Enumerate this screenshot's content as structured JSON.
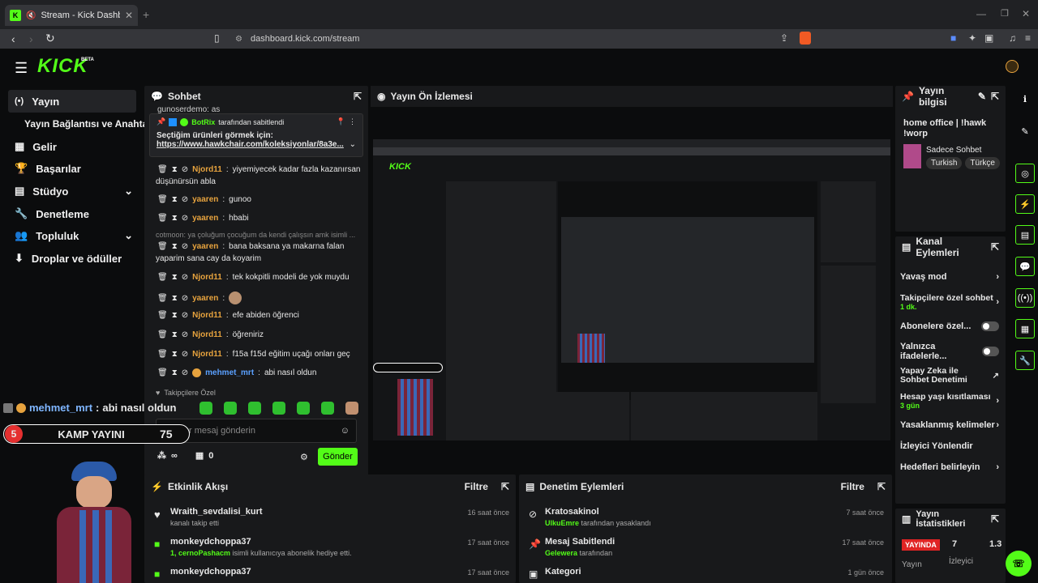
{
  "browser": {
    "tab_title": "Stream - Kick Dashboard",
    "url": "dashboard.kick.com/stream"
  },
  "brand": {
    "logo": "KICK",
    "beta": "BETA",
    "accent": "#53fc18"
  },
  "sidebar": {
    "items": [
      {
        "label": "Yayın",
        "icon": "broadcast-icon"
      },
      {
        "label": "Yayın Bağlantısı ve Anahtarı"
      },
      {
        "label": "Gelir",
        "icon": "chart-icon"
      },
      {
        "label": "Başarılar",
        "icon": "trophy-icon"
      },
      {
        "label": "Stüdyo",
        "icon": "studio-icon"
      },
      {
        "label": "Denetleme",
        "icon": "wrench-icon"
      },
      {
        "label": "Topluluk",
        "icon": "community-icon"
      },
      {
        "label": "Droplar ve ödüller",
        "icon": "drops-icon"
      }
    ]
  },
  "chat": {
    "title": "Sohbet",
    "top_cut": "gunoserdemo: as",
    "pinned": {
      "by_user": "BotRix",
      "by_text": "tarafından sabitlendi",
      "line1": "Seçtiğim ürünleri görmek için:",
      "line2": "https://www.hawkchair.com/koleksiyonlar/8a3e..."
    },
    "messages": [
      {
        "user": "Njord11",
        "text": "yiyemiyecek kadar fazla kazanırsan",
        "text2": "düşünürsün abla"
      },
      {
        "user": "yaaren",
        "text": "gunoo"
      },
      {
        "user": "yaaren",
        "text": "hbabi"
      },
      {
        "reply": "cotmoon: ya çoluğum çocuğum da kendi çalışsın amk isimli ..."
      },
      {
        "user": "yaaren",
        "text": "bana baksana ya makarna falan",
        "text2": "yaparim sana cay da koyarim"
      },
      {
        "user": "Njord11",
        "text": "tek kokpitli modeli de yok muydu"
      },
      {
        "user": "yaaren",
        "text": ""
      },
      {
        "user": "Njord11",
        "text": "efe abiden öğrenci"
      },
      {
        "user": "Njord11",
        "text": "öğreniriz"
      },
      {
        "user": "Njord11",
        "text": "f15a f15d eğitim uçağı onları geç"
      },
      {
        "user": "mehmet_mrt",
        "text": "abi nasıl oldun"
      }
    ],
    "followers_only": "Takipçilere Özel",
    "input_placeholder": "r mesaj gönderin",
    "send_label": "Gönder",
    "counter_left": "∞",
    "counter_right": "0"
  },
  "preview": {
    "title": "Yayın Ön İzlemesi",
    "overlay_user": "mehmet_mrt",
    "overlay_text": "abi nasıl oldun",
    "overlay_level": "5",
    "overlay_banner": "KAMP YAYINI",
    "overlay_number": "75"
  },
  "stream_info": {
    "title": "Yayın bilgisi",
    "stream_title": "home office | !hawk !worp",
    "category": "Sadece Sohbet",
    "tags": [
      "Turkish",
      "Türkçe"
    ]
  },
  "channel_actions": {
    "title": "Kanal Eylemleri",
    "items": [
      {
        "label": "Yavaş mod",
        "type": "arrow"
      },
      {
        "label": "Takipçilere özel sohbet",
        "sub": "1 dk.",
        "type": "arrow"
      },
      {
        "label": "Abonelere özel...",
        "type": "toggle"
      },
      {
        "label": "Yalnızca ifadelerle...",
        "type": "toggle"
      },
      {
        "label": "Yapay Zeka ile Sohbet Denetimi",
        "type": "external"
      },
      {
        "label": "Hesap yaşı kısıtlaması",
        "sub": "3 gün",
        "type": "arrow"
      },
      {
        "label": "Yasaklanmış kelimeler",
        "type": "arrow"
      },
      {
        "label": "İzleyici Yönlendir",
        "type": "none"
      },
      {
        "label": "Hedefleri belirleyin",
        "type": "arrow"
      }
    ]
  },
  "stats": {
    "title": "Yayın İstatistikleri",
    "live": "YAYINDA",
    "live_sub": "Yayın",
    "viewers": "7",
    "viewers_label": "İzleyici",
    "extra": "1.3"
  },
  "activity": {
    "title": "Etkinlik Akışı",
    "filter": "Filtre",
    "rows": [
      {
        "user": "Wraith_sevdalisi_kurt",
        "sub": "kanalı takip etti",
        "time": "16 saat önce",
        "icon": "heart-icon"
      },
      {
        "user": "monkeydchoppa37",
        "sub_user": "1, cernoPashacm",
        "sub": "isimli kullanıcıya abonelik hediye etti.",
        "time": "17 saat önce",
        "icon": "gift-icon"
      },
      {
        "user": "monkeydchoppa37",
        "sub": "",
        "time": "17 saat önce",
        "icon": "gift-icon"
      }
    ]
  },
  "moderation": {
    "title": "Denetim Eylemleri",
    "filter": "Filtre",
    "rows": [
      {
        "user": "Kratosakinol",
        "sub_user": "UlkuEmre",
        "sub": "tarafından yasaklandı",
        "time": "7 saat önce",
        "icon": "ban-icon"
      },
      {
        "user": "Mesaj Sabitlendi",
        "sub_user": "Gelewera",
        "sub": "tarafından",
        "time": "17 saat önce",
        "icon": "pin-icon"
      },
      {
        "user": "Kategori",
        "sub": "",
        "time": "1 gün önce",
        "icon": "category-icon"
      }
    ]
  }
}
